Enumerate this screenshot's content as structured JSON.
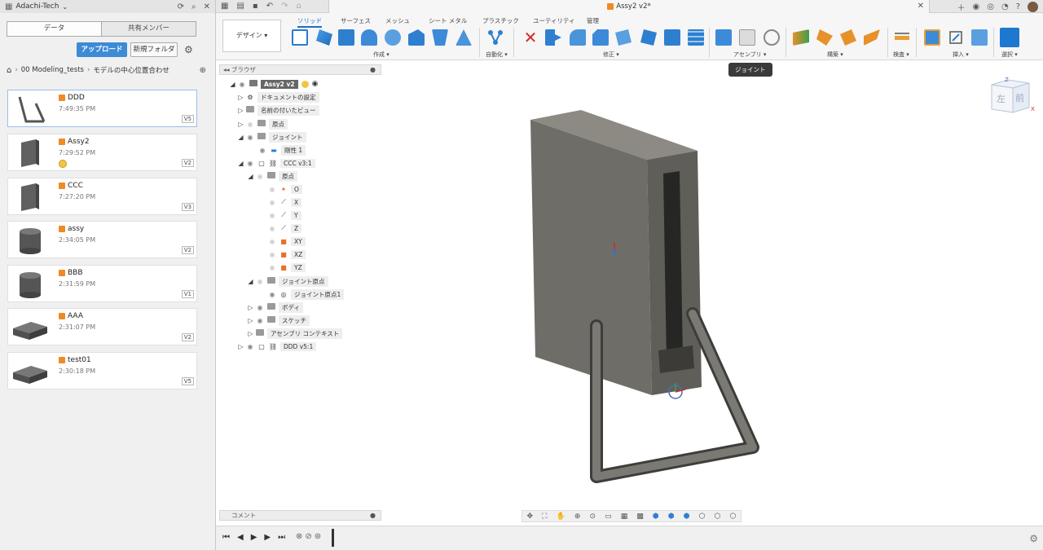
{
  "app": {
    "team_name": "Adachi-Tech",
    "document_title": "Assy2 v2*"
  },
  "data_panel": {
    "tabs": [
      "データ",
      "共有メンバー"
    ],
    "upload_label": "アップロード",
    "new_folder_label": "新規フォルダ",
    "breadcrumb": [
      "00 Modeling_tests",
      "モデルの中心位置合わせ"
    ],
    "files": [
      {
        "name": "DDD",
        "time": "7:49:35 PM",
        "version": "V5",
        "thumb": "bent-rod"
      },
      {
        "name": "Assy2",
        "time": "7:29:52 PM",
        "version": "V2",
        "thumb": "block"
      },
      {
        "name": "CCC",
        "time": "7:27:20 PM",
        "version": "V3",
        "thumb": "block"
      },
      {
        "name": "assy",
        "time": "2:34:05 PM",
        "version": "V2",
        "thumb": "cylinder"
      },
      {
        "name": "BBB",
        "time": "2:31:59 PM",
        "version": "V1",
        "thumb": "cylinder"
      },
      {
        "name": "AAA",
        "time": "2:31:07 PM",
        "version": "V2",
        "thumb": "plate"
      },
      {
        "name": "test01",
        "time": "2:30:18 PM",
        "version": "V5",
        "thumb": "plate"
      }
    ]
  },
  "ribbon": {
    "workspace": "デザイン ▾",
    "tabs": [
      "ソリッド",
      "サーフェス",
      "メッシュ",
      "シート メタル",
      "プラスチック",
      "ユーティリティ",
      "管理"
    ],
    "groups": [
      "作成 ▾",
      "自動化 ▾",
      "修正 ▾",
      "アセンブリ ▾",
      "構築 ▾",
      "検査 ▾",
      "挿入 ▾",
      "選択 ▾"
    ],
    "tooltip": "ジョイント"
  },
  "browser": {
    "title": "ブラウザ",
    "nodes": [
      {
        "label": "Assy2 v2",
        "level": 0,
        "tri": "◢",
        "root": true
      },
      {
        "label": "ドキュメントの設定",
        "level": 1,
        "tri": "▷"
      },
      {
        "label": "名前の付いたビュー",
        "level": 1,
        "tri": "▷"
      },
      {
        "label": "原点",
        "level": 1,
        "tri": "▷"
      },
      {
        "label": "ジョイント",
        "level": 1,
        "tri": "◢"
      },
      {
        "label": "剛性 1",
        "level": 2,
        "tri": ""
      },
      {
        "label": "CCC v3:1",
        "level": 1,
        "tri": "◢"
      },
      {
        "label": "原点",
        "level": 2,
        "tri": "◢"
      },
      {
        "label": "O",
        "level": 3,
        "tri": ""
      },
      {
        "label": "X",
        "level": 3,
        "tri": ""
      },
      {
        "label": "Y",
        "level": 3,
        "tri": ""
      },
      {
        "label": "Z",
        "level": 3,
        "tri": ""
      },
      {
        "label": "XY",
        "level": 3,
        "tri": ""
      },
      {
        "label": "XZ",
        "level": 3,
        "tri": ""
      },
      {
        "label": "YZ",
        "level": 3,
        "tri": ""
      },
      {
        "label": "ジョイント原点",
        "level": 2,
        "tri": "◢"
      },
      {
        "label": "ジョイント原点1",
        "level": 3,
        "tri": ""
      },
      {
        "label": "ボディ",
        "level": 2,
        "tri": "▷"
      },
      {
        "label": "スケッチ",
        "level": 2,
        "tri": "▷"
      },
      {
        "label": "アセンブリ コンテキスト",
        "level": 2,
        "tri": "▷"
      },
      {
        "label": "DDD v5:1",
        "level": 1,
        "tri": "▷"
      }
    ],
    "comment_label": "コメント"
  },
  "viewcube": {
    "left": "左",
    "front": "前",
    "axis_z": "Z",
    "axis_x": "X"
  }
}
